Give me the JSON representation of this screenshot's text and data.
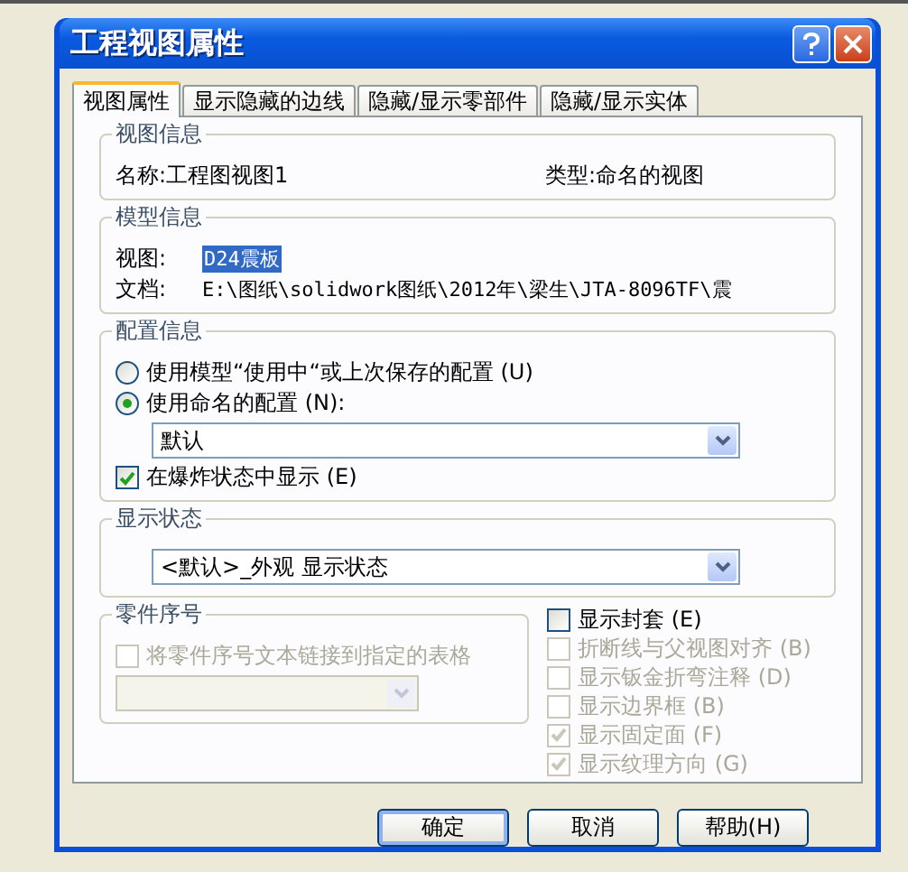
{
  "window": {
    "title": "工程视图属性"
  },
  "tabs": [
    {
      "label": "视图属性",
      "selected": true
    },
    {
      "label": "显示隐藏的边线",
      "selected": false
    },
    {
      "label": "隐藏/显示零部件",
      "selected": false
    },
    {
      "label": "隐藏/显示实体",
      "selected": false
    }
  ],
  "view_info": {
    "title": "视图信息",
    "name_label": "名称:",
    "name_value": "工程图视图1",
    "type_label": "类型:",
    "type_value": "命名的视图"
  },
  "model_info": {
    "title": "模型信息",
    "view_label": "视图:",
    "view_value": "D24震板",
    "view_value_highlighted": true,
    "document_label": "文档:",
    "document_value": "E:\\图纸\\solidwork图纸\\2012年\\梁生\\JTA-8096TF\\震"
  },
  "configuration": {
    "title": "配置信息",
    "options": [
      {
        "label": "使用模型“使用中“或上次保存的配置 (U)",
        "selected": false
      },
      {
        "label": "使用命名的配置 (N):",
        "selected": true
      }
    ],
    "dropdown": {
      "value": "默认"
    },
    "checkbox": {
      "label": "在爆炸状态中显示 (E)",
      "checked": true
    }
  },
  "display_state": {
    "title": "显示状态",
    "dropdown": {
      "value": "<默认>_外观 显示状态"
    }
  },
  "balloons": {
    "title": "零件序号",
    "checkbox": {
      "label": "将零件序号文本链接到指定的表格",
      "checked": false,
      "disabled": true
    },
    "dropdown": {
      "disabled": true
    }
  },
  "options": [
    {
      "label": "显示封套 (E)",
      "checked": false,
      "disabled": false
    },
    {
      "label": "折断线与父视图对齐 (B)",
      "checked": false,
      "disabled": true
    },
    {
      "label": "显示钣金折弯注释 (D)",
      "checked": false,
      "disabled": true
    },
    {
      "label": "显示边界框 (B)",
      "checked": false,
      "disabled": true
    },
    {
      "label": "显示固定面 (F)",
      "checked": true,
      "disabled": true
    },
    {
      "label": "显示纹理方向 (G)",
      "checked": true,
      "disabled": true
    }
  ],
  "buttons": [
    {
      "label": "确定",
      "default": true
    },
    {
      "label": "取消",
      "default": false
    },
    {
      "label": "帮助(H)",
      "default": false
    }
  ]
}
